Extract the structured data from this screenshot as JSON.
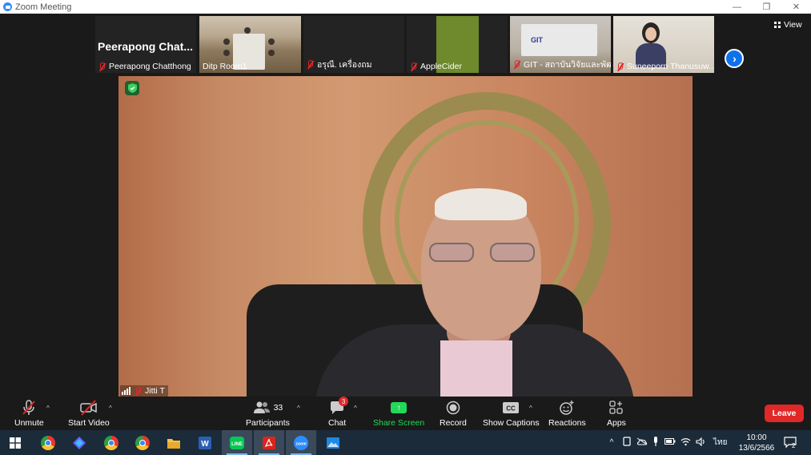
{
  "window": {
    "title": "Zoom Meeting"
  },
  "gallery": [
    {
      "name": "Peerapong Chatthong",
      "big_name": "Peerapong  Chat...",
      "muted": true
    },
    {
      "name": "Ditp Room1",
      "muted": false
    },
    {
      "name": "อรุณี. เครื่องถม",
      "muted": true
    },
    {
      "name": "AppleCider",
      "muted": true
    },
    {
      "name": "GIT - สถาบันวิจัยและพัฒ...",
      "logo": "GIT",
      "muted": true
    },
    {
      "name": "Suneeporn Thanusuw...",
      "muted": true
    }
  ],
  "view_label": "View",
  "speaker": {
    "name": "Jitti T",
    "muted": true
  },
  "toolbar": {
    "unmute": "Unmute",
    "start_video": "Start Video",
    "participants": "Participants",
    "participants_count": "33",
    "chat": "Chat",
    "chat_badge": "3",
    "share_screen": "Share Screen",
    "record": "Record",
    "show_captions": "Show Captions",
    "reactions": "Reactions",
    "apps": "Apps",
    "leave": "Leave"
  },
  "taskbar": {
    "lang": "ไทย",
    "time": "10:00",
    "date": "13/6/2566",
    "notif_count": "2",
    "apps": [
      "windows-start",
      "chrome",
      "copilot",
      "chrome",
      "chrome",
      "file-explorer",
      "word",
      "line",
      "acrobat",
      "zoom",
      "photos"
    ]
  },
  "colors": {
    "accent": "#2d8cff",
    "share": "#23d959",
    "leave": "#e02828",
    "next": "#0e72ed",
    "taskbar": "#1c2b3a"
  }
}
